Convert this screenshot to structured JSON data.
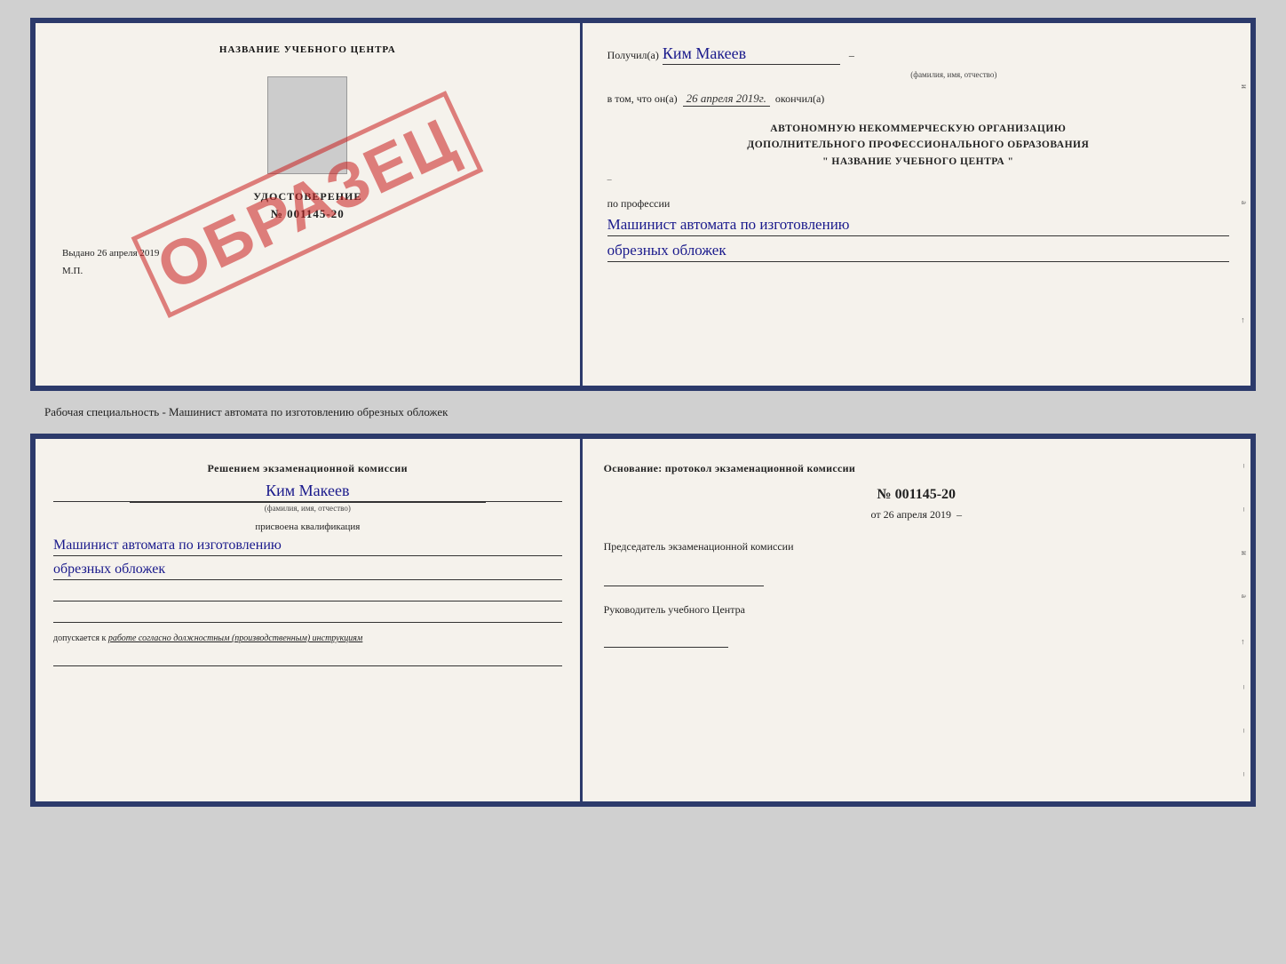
{
  "topDoc": {
    "left": {
      "title": "НАЗВАНИЕ УЧЕБНОГО ЦЕНТРА",
      "certLabel": "УДОСТОВЕРЕНИЕ",
      "certNumber": "№ 001145-20",
      "issuedLine": "Выдано 26 апреля 2019",
      "mpLabel": "М.П.",
      "obrazec": "ОБРАЗЕЦ"
    },
    "right": {
      "receivedPrefix": "Получил(а)",
      "recipientName": "Ким Макеев",
      "fioSubLabel": "(фамилия, имя, отчество)",
      "datePrefix": "в том, что он(а)",
      "date": "26 апреля 2019г.",
      "datePostfix": "окончил(а)",
      "orgLine1": "АВТОНОМНУЮ НЕКОММЕРЧЕСКУЮ ОРГАНИЗАЦИЮ",
      "orgLine2": "ДОПОЛНИТЕЛЬНОГО ПРОФЕССИОНАЛЬНОГО ОБРАЗОВАНИЯ",
      "orgLine3": "\" НАЗВАНИЕ УЧЕБНОГО ЦЕНТРА \"",
      "professionLabel": "по профессии",
      "profession1": "Машинист автомата по изготовлению",
      "profession2": "обрезных обложек"
    }
  },
  "caption": "Рабочая специальность - Машинист автомата по изготовлению обрезных обложек",
  "bottomDoc": {
    "left": {
      "commissionHeader": "Решением экзаменационной комиссии",
      "personName": "Ким Макеев",
      "fioSubLabel": "(фамилия, имя, отчество)",
      "assignedLabel": "присвоена квалификация",
      "qual1": "Машинист автомата по изготовлению",
      "qual2": "обрезных обложек",
      "allowedPrefix": "допускается к",
      "allowedText": "работе согласно должностным (производственным) инструкциям"
    },
    "right": {
      "basisLabel": "Основание: протокол экзаменационной комиссии",
      "protocolNumber": "№ 001145-20",
      "protocolDatePrefix": "от",
      "protocolDate": "26 апреля 2019",
      "chairmanLabel": "Председатель экзаменационной комиссии",
      "headLabel": "Руководитель учебного Центра"
    }
  }
}
